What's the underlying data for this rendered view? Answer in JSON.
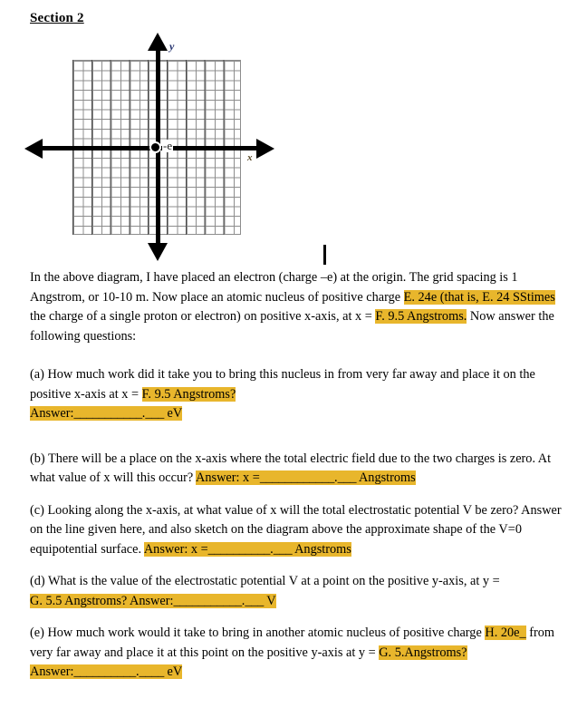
{
  "heading": {
    "text": "Section 2"
  },
  "diagram": {
    "axis_label_y": "y",
    "axis_label_x": "x",
    "charge_label": "-e",
    "grid_columns": 18,
    "grid_rows": 18
  },
  "intro": {
    "line1": "In the above diagram, I have placed an electron (charge –e) at the origin. The grid spacing is 1",
    "line2_pre": "Angstrom, or 10-10 m. Now place an atomic nucleus of positive charge ",
    "charge_value": "E. 24e (that is, E. 24 SStimes",
    "line2_mid": " the charge of a single proton or electron) on positive x-axis, at x = ",
    "position_value": "F. 9.5 Angstroms.",
    "line3": "Now answer the following questions:"
  },
  "questions": [
    {
      "id": "a",
      "text_pre": "(a) How much work did it take you to bring this nucleus in from very far away and place it on the positive x-axis at x = ",
      "highlight_inline": "F. 9.5 Angstroms?",
      "answer_label": "Answer:",
      "blank1": "___________",
      "blank_dot": ".",
      "blank2": "___",
      "unit": "eV"
    },
    {
      "id": "b",
      "text_pre": "(b) There will be a place on the x-axis where the total electric field due to the two charges is zero. At what value of x will this occur? ",
      "answer_label": "Answer: x =",
      "blank1": "____________",
      "blank_dot": ".",
      "blank2": "___",
      "unit": "Angstroms"
    },
    {
      "id": "c",
      "text_pre": "(c) Looking along the x-axis, at what value of x will the total electrostatic potential V be zero? Answer on the line given here, and also sketch on the diagram above the approximate shape of the V=0 equipotential surface. ",
      "answer_label": "Answer: x =",
      "blank1": "__________",
      "blank_dot": ".",
      "blank2": "___",
      "unit": "Angstroms"
    },
    {
      "id": "d",
      "text_pre": "(d) What is the value of the electrostatic potential V at a point on the positive y-axis, at y = ",
      "highlight_lead": "G. 5.5 Angstroms? Answer:",
      "blank1": "___________",
      "blank_dot": ".",
      "blank2": "___",
      "unit": "V"
    },
    {
      "id": "e",
      "text_pre": "(e) How much work would it take to bring in another atomic nucleus of positive charge ",
      "charge_value": "H. 20e_",
      "text_mid": "from very far away and place it at this point on the positive y-axis at y = ",
      "position_value": "G. 5.Angstroms?",
      "answer_label": "Answer:",
      "blank1": "__________",
      "blank_dot": ".",
      "blank2": "____",
      "unit": "eV"
    }
  ],
  "colors": {
    "highlight": "#e8b62c",
    "axis_label_y": "#1f2d6b",
    "axis_label_x": "#5a4a28",
    "grid_line": "#8d8d8d",
    "grid_line_dark": "#4a4a4a"
  }
}
